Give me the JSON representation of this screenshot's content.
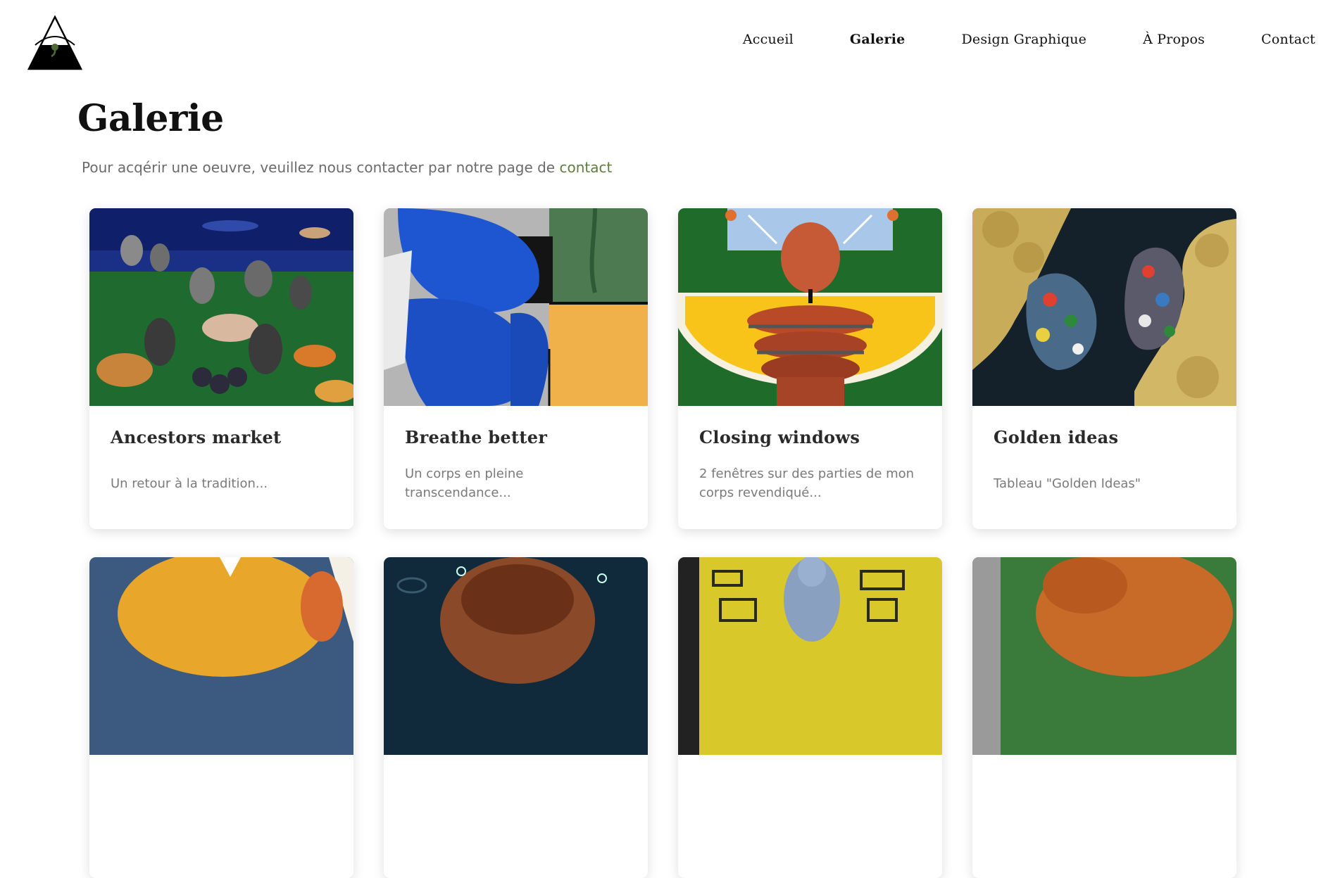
{
  "logo": {
    "icon": "eye-triangle-logo",
    "color": "#000000",
    "accent": "#4e6b32"
  },
  "nav": {
    "items": [
      {
        "label": "Accueil",
        "active": false
      },
      {
        "label": "Galerie",
        "active": true
      },
      {
        "label": "Design Graphique",
        "active": false
      },
      {
        "label": "À Propos",
        "active": false
      },
      {
        "label": "Contact",
        "active": false
      }
    ]
  },
  "page": {
    "title": "Galerie",
    "intro_text": "Pour acqérir une oeuvre, veuillez nous contacter par notre page de ",
    "intro_link": "contact",
    "link_color": "#5e7d3d"
  },
  "gallery": {
    "cards": [
      {
        "title": "Ancestors market",
        "description": "Un retour à la tradition..."
      },
      {
        "title": "Breathe better",
        "description": "Un corps en pleine transcendance..."
      },
      {
        "title": "Closing windows",
        "description": "2 fenêtres sur des parties de mon corps revendiqué..."
      },
      {
        "title": "Golden ideas",
        "description": "Tableau \"Golden Ideas\""
      }
    ]
  }
}
